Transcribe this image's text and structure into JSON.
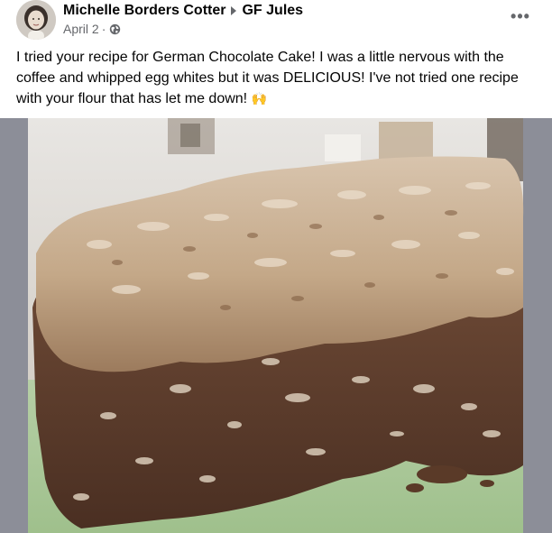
{
  "post": {
    "author": "Michelle Borders Cotter",
    "group": "GF Jules",
    "date": "April 2",
    "separator": "·",
    "more_label": "•••",
    "text": "I tried your recipe for German Chocolate Cake! I was a little nervous with the coffee and whipped egg whites but it was DELICIOUS! I've not tried one recipe with your flour that has let me down!",
    "emoji": "🙌",
    "icons": {
      "audience": "globe-icon",
      "arrow": "triangle-right-icon",
      "more": "more-horizontal-icon"
    }
  },
  "colors": {
    "name_text": "#050505",
    "meta_text": "#65676b",
    "photo_frame": "#8c8e98"
  }
}
